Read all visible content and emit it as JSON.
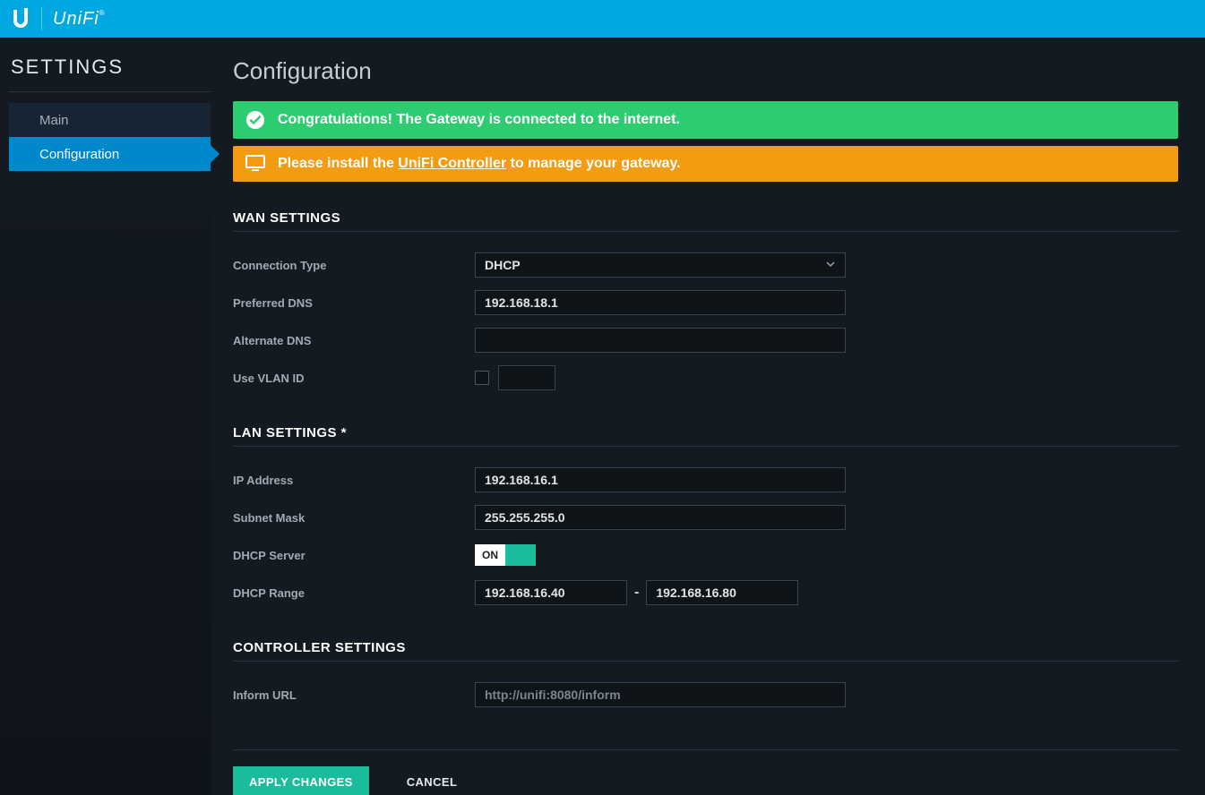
{
  "header": {
    "brand": "UniFi"
  },
  "sidebar": {
    "title": "SETTINGS",
    "items": [
      {
        "label": "Main"
      },
      {
        "label": "Configuration"
      }
    ],
    "active_index": 1
  },
  "page": {
    "title": "Configuration"
  },
  "alerts": {
    "success": "Congratulations! The Gateway is connected to the internet.",
    "warn_prefix": "Please install the ",
    "warn_link": "UniFi Controller",
    "warn_suffix": " to manage your gateway."
  },
  "wan": {
    "section_title": "WAN SETTINGS",
    "labels": {
      "connection_type": "Connection Type",
      "preferred_dns": "Preferred DNS",
      "alternate_dns": "Alternate DNS",
      "use_vlan": "Use VLAN ID"
    },
    "values": {
      "connection_type": "DHCP",
      "preferred_dns": "192.168.18.1",
      "alternate_dns": "",
      "use_vlan_checked": false,
      "vlan_id": ""
    }
  },
  "lan": {
    "section_title": "LAN SETTINGS *",
    "labels": {
      "ip_address": "IP Address",
      "subnet_mask": "Subnet Mask",
      "dhcp_server": "DHCP Server",
      "dhcp_range": "DHCP Range"
    },
    "values": {
      "ip_address": "192.168.16.1",
      "subnet_mask": "255.255.255.0",
      "dhcp_server_state": "ON",
      "dhcp_range_start": "192.168.16.40",
      "dhcp_range_end": "192.168.16.80"
    }
  },
  "controller": {
    "section_title": "CONTROLLER SETTINGS",
    "labels": {
      "inform_url": "Inform URL"
    },
    "values": {
      "inform_url_placeholder": "http://unifi:8080/inform",
      "inform_url": ""
    }
  },
  "buttons": {
    "apply": "APPLY CHANGES",
    "cancel": "CANCEL"
  }
}
